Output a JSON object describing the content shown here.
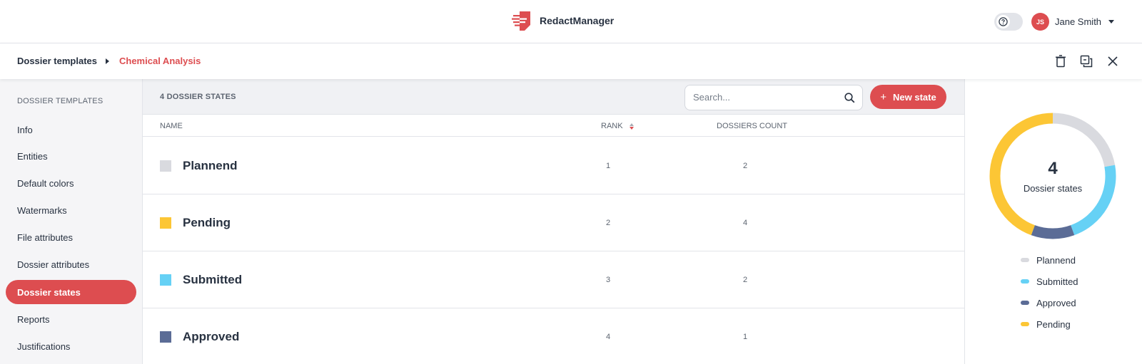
{
  "app": {
    "title": "RedactManager"
  },
  "user": {
    "initials": "JS",
    "name": "Jane Smith"
  },
  "breadcrumb": {
    "root": "Dossier templates",
    "current": "Chemical Analysis"
  },
  "sidebar": {
    "heading": "DOSSIER TEMPLATES",
    "items": [
      {
        "label": "Info"
      },
      {
        "label": "Entities"
      },
      {
        "label": "Default colors"
      },
      {
        "label": "Watermarks"
      },
      {
        "label": "File attributes"
      },
      {
        "label": "Dossier attributes"
      },
      {
        "label": "Dossier states",
        "active": true
      },
      {
        "label": "Reports"
      },
      {
        "label": "Justifications"
      }
    ]
  },
  "table": {
    "count_label": "4 DOSSIER STATES",
    "search_placeholder": "Search...",
    "new_button_label": "New state",
    "columns": {
      "name": "NAME",
      "rank": "RANK",
      "count": "DOSSIERS COUNT"
    },
    "rows": [
      {
        "name": "Plannend",
        "rank": "1",
        "count": "2",
        "color": "#d9dadf"
      },
      {
        "name": "Pending",
        "rank": "2",
        "count": "4",
        "color": "#fcc635"
      },
      {
        "name": "Submitted",
        "rank": "3",
        "count": "2",
        "color": "#66d1f5"
      },
      {
        "name": "Approved",
        "rank": "4",
        "count": "1",
        "color": "#5b6c96"
      }
    ]
  },
  "summary": {
    "total": "4",
    "caption": "Dossier states",
    "legend": [
      {
        "label": "Plannend",
        "color": "#d9dadf"
      },
      {
        "label": "Submitted",
        "color": "#66d1f5"
      },
      {
        "label": "Approved",
        "color": "#5b6c96"
      },
      {
        "label": "Pending",
        "color": "#fcc635"
      }
    ],
    "segments": [
      {
        "label": "Plannend",
        "value": 2,
        "color": "#d9dadf"
      },
      {
        "label": "Submitted",
        "value": 2,
        "color": "#66d1f5"
      },
      {
        "label": "Approved",
        "value": 1,
        "color": "#5b6c96"
      },
      {
        "label": "Pending",
        "value": 4,
        "color": "#fcc635"
      }
    ]
  },
  "colors": {
    "accent": "#dd4d50",
    "text": "#283241",
    "muted": "#5c6470"
  }
}
